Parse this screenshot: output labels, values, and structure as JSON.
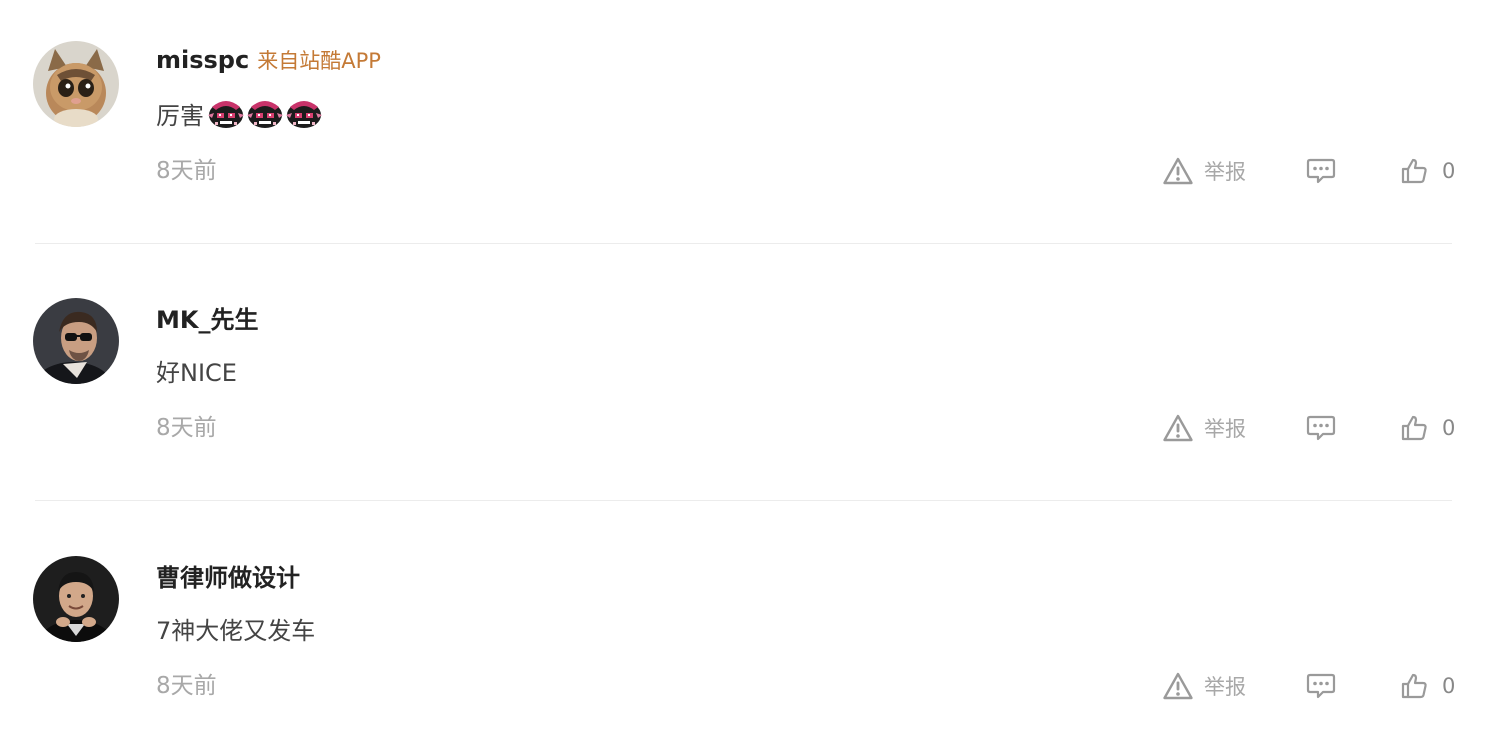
{
  "comments": [
    {
      "username": "misspc",
      "source": "来自站酷APP",
      "text": "厉害",
      "emoji_count": 3,
      "time": "8天前",
      "report_label": "举报",
      "like_count": "0"
    },
    {
      "username": "MK_先生",
      "source": "",
      "text": "好NICE",
      "time": "8天前",
      "report_label": "举报",
      "like_count": "0"
    },
    {
      "username": "曹律师做设计",
      "source": "",
      "text": "7神大佬又发车",
      "time": "8天前",
      "report_label": "举报",
      "like_count": "0"
    }
  ],
  "colors": {
    "source_tag": "#c47a36",
    "username": "#222222",
    "meta": "#a8a8a8",
    "divider": "#ececec"
  },
  "icons": {
    "report": "warning-triangle-icon",
    "reply": "chat-bubble-icon",
    "like": "thumbs-up-icon"
  }
}
